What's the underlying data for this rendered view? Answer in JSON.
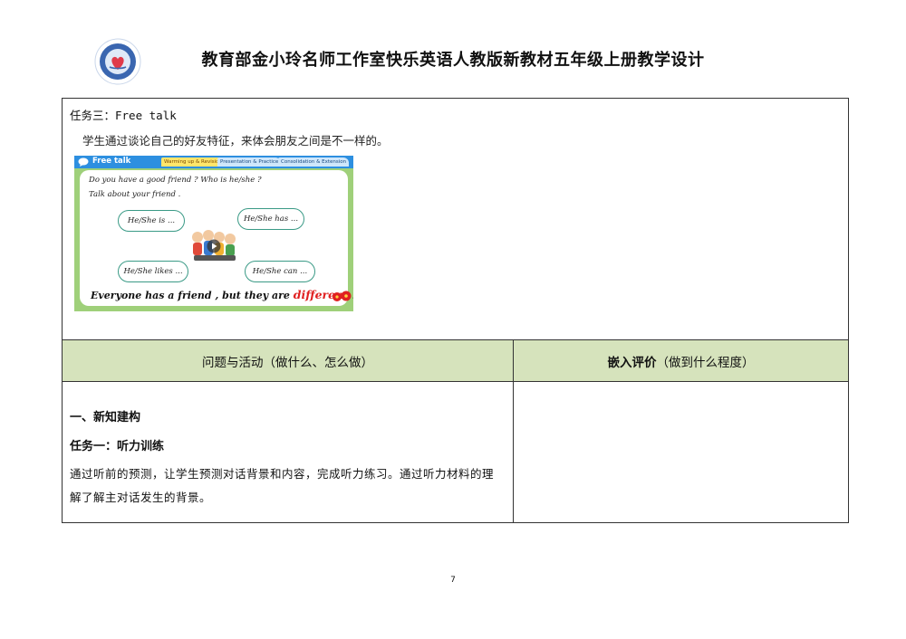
{
  "header": {
    "title": "教育部金小玲名师工作室快乐英语人教版新教材五年级上册教学设计"
  },
  "task3": {
    "title": "任务三：Free talk",
    "description": "学生通过谈论自己的好友特征，来体会朋友之间是不一样的。"
  },
  "slide": {
    "title": "Free talk",
    "tabs": [
      "Warming up & Revision",
      "Presentation & Practice",
      "Consolidation & Extension"
    ],
    "question1": "Do you have a good friend ? Who is he/she ?",
    "question2": "Talk about your friend .",
    "bubbles": [
      "He/She is ...",
      "He/She has ...",
      "He/She likes ...",
      "He/She can ..."
    ],
    "footer_main": "Everyone has a friend , but they are ",
    "footer_highlight": "different",
    "footer_end": " ."
  },
  "table_header": {
    "left_bold": "问题与活动",
    "left_light": "（做什么、怎么做）",
    "right_bold": "嵌入评价",
    "right_light": "（做到什么程度）"
  },
  "section": {
    "title": "一、新知建构",
    "task1_title": "任务一：听力训练",
    "task1_body": "通过听前的预测，让学生预测对话背景和内容，完成听力练习。通过听力材料的理解了解主对话发生的背景。",
    "right_content": ""
  },
  "page_number": "7",
  "colors": {
    "header_row_bg": "#d6e3bc",
    "slide_bar": "#2d8fe0",
    "slide_bg": "#9fd07a",
    "highlight_red": "#e02020"
  }
}
